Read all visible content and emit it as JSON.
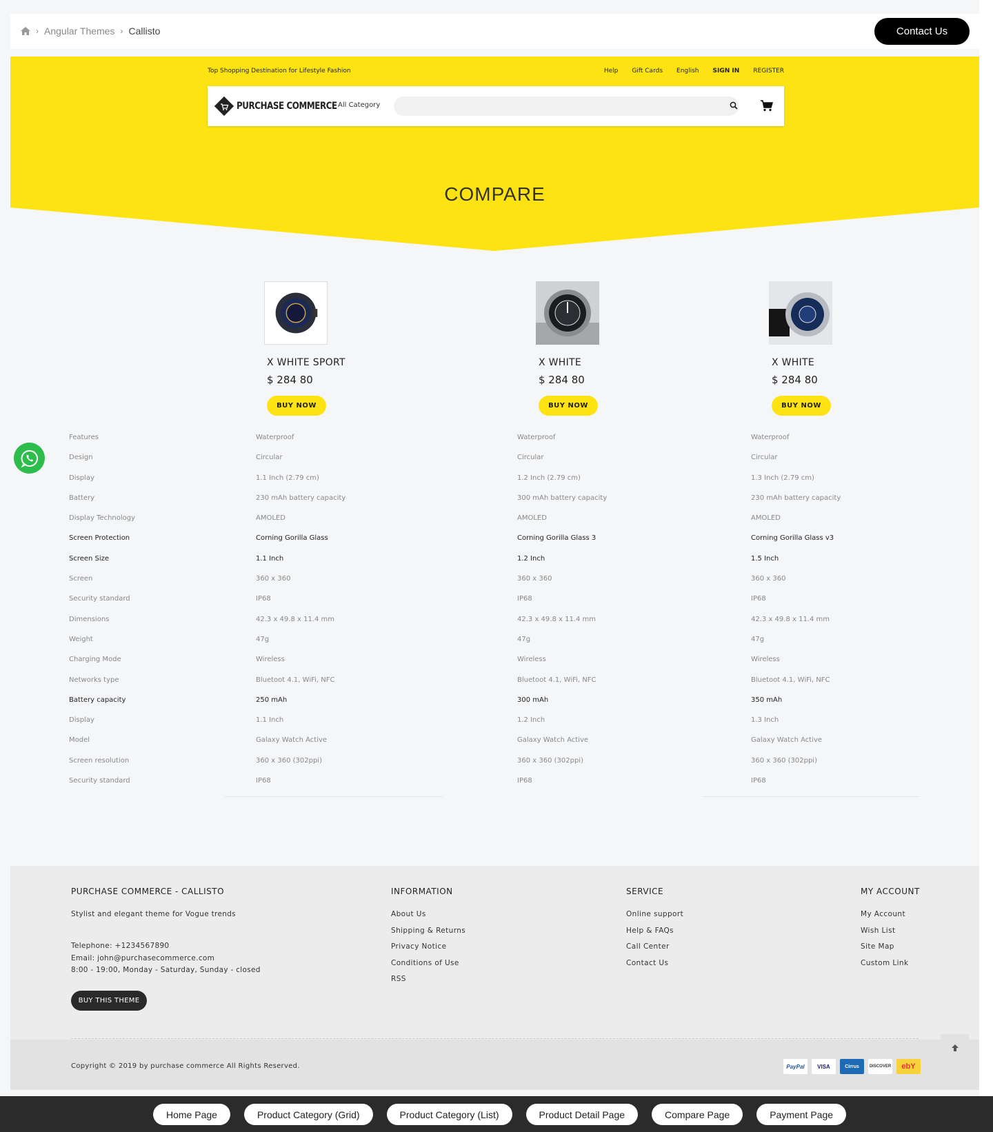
{
  "breadcrumb": {
    "items": [
      "Angular Themes",
      "Callisto"
    ]
  },
  "contact_button": "Contact Us",
  "header": {
    "tagline": "Top Shopping Destination for Lifestyle Fashion",
    "links": [
      "Help",
      "Gift Cards",
      "English",
      "SIGN IN",
      "REGISTER"
    ],
    "logo": "PURCHASE COMMERCE",
    "category": "All Category",
    "search_value": ""
  },
  "page_title": "COMPARE",
  "colors": {
    "accent": "#fde311",
    "whatsapp": "#2ebd4d",
    "dark": "#000000"
  },
  "products": [
    {
      "name": "X WHITE SPORT",
      "price": "$ 284 80",
      "buy": "BUY NOW"
    },
    {
      "name": "X WHITE",
      "price": "$ 284 80",
      "buy": "BUY NOW"
    },
    {
      "name": "X WHITE",
      "price": "$ 284 80",
      "buy": "BUY NOW"
    }
  ],
  "specs": [
    {
      "label": "Features",
      "values": [
        "Waterproof",
        "Waterproof",
        "Waterproof"
      ],
      "dark": false
    },
    {
      "label": "Design",
      "values": [
        "Circular",
        "Circular",
        "Circular"
      ],
      "dark": false
    },
    {
      "label": "Display",
      "values": [
        "1.1 Inch (2.79 cm)",
        "1.2 Inch (2.79 cm)",
        "1.3 Inch (2.79 cm)"
      ],
      "dark": false
    },
    {
      "label": "Battery",
      "values": [
        "230 mAh battery capacity",
        "300 mAh battery capacity",
        "230 mAh battery capacity"
      ],
      "dark": false
    },
    {
      "label": "Display Technology",
      "values": [
        "AMOLED",
        "AMOLED",
        "AMOLED"
      ],
      "dark": false
    },
    {
      "label": "Screen Protection",
      "values": [
        "Corning Gorilla Glass",
        "Corning Gorilla Glass 3",
        "Corning Gorilla Glass v3"
      ],
      "dark": true
    },
    {
      "label": "Screen Size",
      "values": [
        "1.1 Inch",
        "1.2 Inch",
        "1.5 Inch"
      ],
      "dark": true
    },
    {
      "label": "Screen",
      "values": [
        "360 x 360",
        "360 x 360",
        "360 x 360"
      ],
      "dark": false
    },
    {
      "label": "Security standard",
      "values": [
        "IP68",
        "IP68",
        "IP68"
      ],
      "dark": false
    },
    {
      "label": "Dimensions",
      "values": [
        "42.3 x 49.8 x 11.4 mm",
        "42.3 x 49.8 x 11.4 mm",
        "42.3 x 49.8 x 11.4 mm"
      ],
      "dark": false
    },
    {
      "label": "Weight",
      "values": [
        "47g",
        "47g",
        "47g"
      ],
      "dark": false
    },
    {
      "label": "Charging Mode",
      "values": [
        "Wireless",
        "Wireless",
        "Wireless"
      ],
      "dark": false
    },
    {
      "label": "Networks type",
      "values": [
        "Bluetoot 4.1, WiFi, NFC",
        "Bluetoot 4.1, WiFi, NFC",
        "Bluetoot 4.1, WiFi, NFC"
      ],
      "dark": false
    },
    {
      "label": "Battery capacity",
      "values": [
        "250 mAh",
        "300 mAh",
        "350 mAh"
      ],
      "dark": true
    },
    {
      "label": "Display",
      "values": [
        "1.1 Inch",
        "1.2 Inch",
        "1.3 Inch"
      ],
      "dark": false
    },
    {
      "label": "Model",
      "values": [
        "Galaxy Watch Active",
        "Galaxy Watch Active",
        "Galaxy Watch Active"
      ],
      "dark": false
    },
    {
      "label": "Screen resolution",
      "values": [
        "360 x 360 (302ppi)",
        "360 x 360 (302ppi)",
        "360 x 360 (302ppi)"
      ],
      "dark": false
    },
    {
      "label": "Security standard",
      "values": [
        "IP68",
        "IP68",
        "IP68"
      ],
      "dark": false
    }
  ],
  "footer": {
    "about": {
      "title": "PURCHASE COMMERCE - CALLISTO",
      "tagline": "Stylist and elegant theme for Vogue trends",
      "phone": "Telephone: +1234567890",
      "email": "Email: john@purchasecommerce.com",
      "hours": "8:00 - 19:00, Monday - Saturday, Sunday - closed",
      "button": "BUY THIS THEME"
    },
    "information": {
      "title": "INFORMATION",
      "links": [
        "About Us",
        "Shipping & Returns",
        "Privacy Notice",
        "Conditions of Use",
        "RSS"
      ]
    },
    "service": {
      "title": "SERVICE",
      "links": [
        "Online support",
        "Help & FAQs",
        "Call Center",
        "Contact Us"
      ]
    },
    "account": {
      "title": "MY ACCOUNT",
      "links": [
        "My Account",
        "Wish List",
        "Site Map",
        "Custom Link"
      ]
    },
    "copyright": "Copyright © 2019 by purchase commerce All Rights Reserved.",
    "payments": [
      "PayPal",
      "VISA",
      "Cirrus",
      "DISCOVER",
      "ebY"
    ]
  },
  "demo_links": [
    "Home Page",
    "Product Category (Grid)",
    "Product Category (List)",
    "Product Detail Page",
    "Compare Page",
    "Payment Page"
  ]
}
